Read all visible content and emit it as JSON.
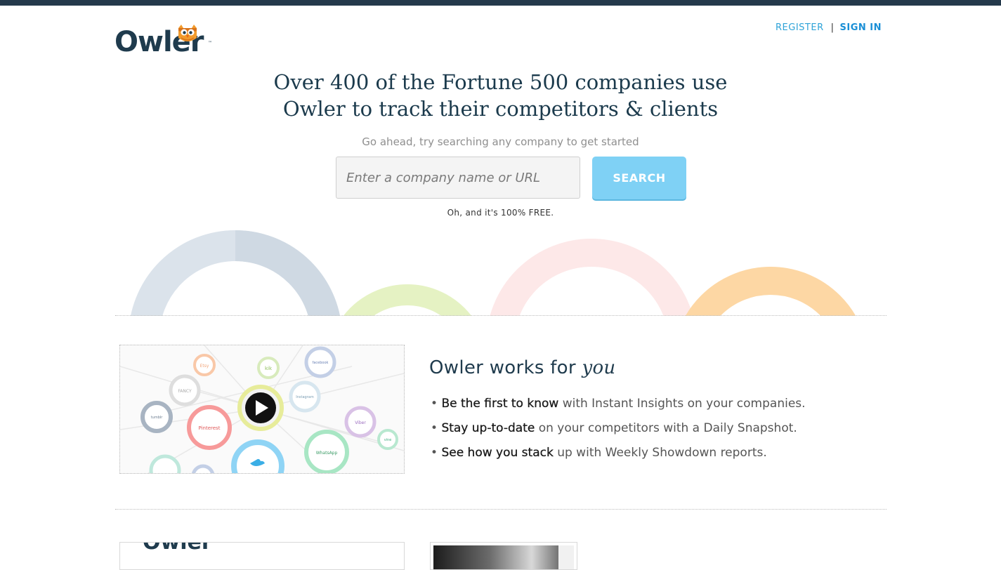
{
  "header": {
    "logo_text": "Owler",
    "logo_tm": "™",
    "register_label": "REGISTER",
    "separator": "|",
    "signin_label": "SIGN IN"
  },
  "hero": {
    "title_line1": "Over 400 of the Fortune 500 companies use",
    "title_line2": "Owler to track their competitors & clients",
    "subtitle": "Go ahead, try searching any company to get started",
    "search_placeholder": "Enter a company name or URL",
    "search_button": "SEARCH",
    "free_note": "Oh, and it's 100% FREE."
  },
  "video": {
    "bubbles": [
      "Etsy",
      "kik",
      "facebook",
      "FANCY",
      "Instagram",
      "tumblr",
      "Pinterest",
      "Viber",
      "WhatsApp",
      "vine"
    ]
  },
  "features": {
    "title_prefix": "Owler works for ",
    "title_emphasis": "you",
    "items": [
      {
        "bold": "Be the first to know",
        "rest": " with Instant Insights on your companies."
      },
      {
        "bold": "Stay up-to-date",
        "rest": " on your competitors with a Daily Snapshot."
      },
      {
        "bold": "See how you stack",
        "rest": " up with Weekly Showdown reports."
      }
    ]
  },
  "colors": {
    "topbar": "#24394b",
    "brand_navy": "#1f3b4d",
    "link_blue": "#2ea3d8",
    "search_button": "#7fd1f5",
    "owl_orange": "#f29b2c"
  },
  "icons": {
    "owl": "owl-mascot-icon",
    "play": "play-icon",
    "twitter": "twitter-bird-icon"
  }
}
